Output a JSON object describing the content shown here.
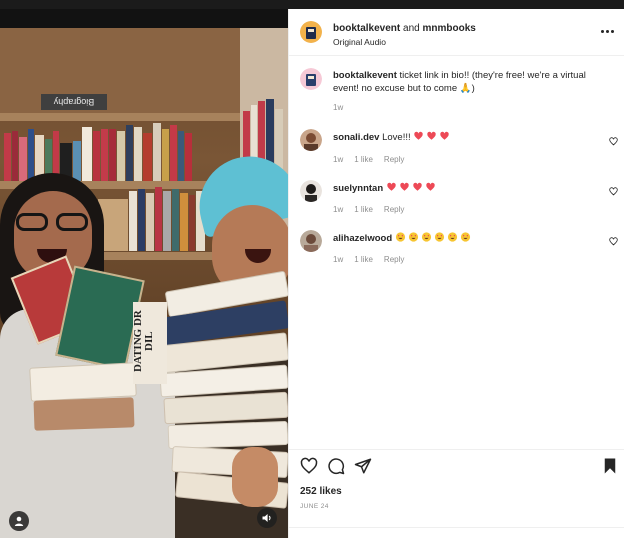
{
  "post": {
    "header": {
      "author_primary": "booktalkevent",
      "connector": " and ",
      "author_secondary": "mnmbooks",
      "audio": "Original Audio"
    },
    "media": {
      "sign_text": "Biography",
      "book_title": "DATING DR DIL"
    },
    "caption": {
      "username": "booktalkevent",
      "text": "ticket link in bio!! (they're free! we're a virtual event! no excuse but to come 🙏)",
      "time": "1w"
    },
    "comments": [
      {
        "username": "sonali.dev",
        "text": "Love!!!",
        "emoji": [
          "red-heart",
          "red-heart",
          "red-heart"
        ],
        "time": "1w",
        "likes": "1 like",
        "reply": "Reply"
      },
      {
        "username": "suelynntan",
        "text": "",
        "emoji": [
          "red-heart",
          "red-heart",
          "red-heart",
          "red-heart"
        ],
        "time": "1w",
        "likes": "1 like",
        "reply": "Reply"
      },
      {
        "username": "alihazelwood",
        "text": "",
        "emoji": [
          "heart-eyes",
          "heart-eyes",
          "heart-eyes",
          "heart-eyes",
          "heart-eyes",
          "heart-eyes"
        ],
        "time": "1w",
        "likes": "1 like",
        "reply": "Reply"
      }
    ],
    "likes": "252 likes",
    "date": "JUNE 24"
  },
  "colors": {
    "accent_teal_cap": "#5ec0d3",
    "text": "#262626",
    "muted": "#8e8e8e",
    "heart_red": "#ed4956"
  },
  "icons": [
    "more-options-icon",
    "like-icon",
    "comment-icon",
    "share-icon",
    "save-icon",
    "comment-like-icon",
    "user-tag-icon",
    "audio-icon"
  ]
}
